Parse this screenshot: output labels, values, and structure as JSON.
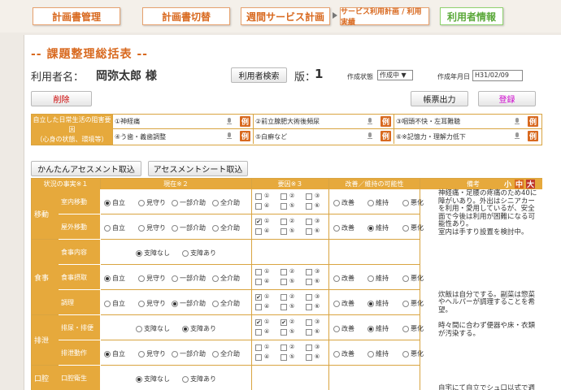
{
  "nav": {
    "tabs": [
      "計画書管理",
      "計画書切替",
      "週間サービス計画",
      "サービス利用計画 / 利用実績",
      "利用者情報"
    ]
  },
  "page": {
    "title": "-- 課題整理総括表 --",
    "user_label": "利用者名：",
    "user_name": "岡弥太郎 様",
    "search_button": "利用者検索",
    "version_label": "版：",
    "version": "1",
    "status_label": "作成状態",
    "status_value": "作成中 ▼",
    "date_label": "作成年月日",
    "date_value": "H31/02/09",
    "delete_button": "削除",
    "print_button": "帳票出力",
    "register_button": "登録",
    "easy_assess_button": "かんたんアセスメント取込",
    "assess_sheet_button": "アセスメントシート取込"
  },
  "header_block": {
    "label": "自立した日常生活の阻害要因\n（心身の状態、環境等）",
    "factors": [
      "①神経痛",
      "②前立腺肥大術後頻尿",
      "③咽頭不快・左耳難聴",
      "④う歯・義歯調整",
      "⑤白癬など",
      "⑥※記憶力・理解力低下"
    ],
    "rei": "例"
  },
  "table": {
    "headers": [
      "状況の事実※１",
      "現在※２",
      "要因※３",
      "改善／維持の可能性",
      "備考"
    ],
    "size_labels": [
      "小",
      "中",
      "大"
    ],
    "current_options": [
      "自立",
      "見守り",
      "一部介助",
      "全介助"
    ],
    "support_options": [
      "支障なし",
      "支障あり"
    ],
    "possibility_options": [
      "改善",
      "維持",
      "悪化"
    ],
    "factor_nums": [
      "①",
      "②",
      "③",
      "④",
      "⑤",
      "⑥"
    ],
    "categories": [
      "移動",
      "食事",
      "排泄",
      "口腔"
    ],
    "rows": [
      {
        "item": "室内移動",
        "type": "four",
        "sel": 0,
        "checks": [],
        "poss": -1
      },
      {
        "item": "屋外移動",
        "type": "four",
        "sel": -1,
        "checks": [
          0
        ],
        "poss": 1
      },
      {
        "item": "食事内容",
        "type": "two",
        "sel": 0,
        "checks": [],
        "poss": -1
      },
      {
        "item": "食事摂取",
        "type": "four",
        "sel": 0,
        "checks": [],
        "poss": -1
      },
      {
        "item": "調理",
        "type": "four",
        "sel": 2,
        "checks": [
          0
        ],
        "poss": 1
      },
      {
        "item": "排尿・排便",
        "type": "two",
        "sel": 1,
        "checks": [
          0,
          1
        ],
        "poss": 1
      },
      {
        "item": "排泄動作",
        "type": "four",
        "sel": 0,
        "checks": [],
        "poss": -1
      },
      {
        "item": "口腔衛生",
        "type": "two",
        "sel": 0,
        "checks": [],
        "poss": -1
      }
    ],
    "notes": "神経痛・足腰の疼痛のため40に障がいあり。外出はシニアカーを利用・愛用しているが、安全面で今後は利用が困難になる可能性あり。\n室内は手すり設置を検討中。\n\n\n\n\n\n\n\n炊飯は自分でする。副菜は惣菜やヘルパーが調理することを希望。\n\n時々間に合わず便器や床・衣類が汚染する。\n\n\n\n\n\n\n自宅にて自立でシュ口以式で週"
  },
  "colors": {
    "accent": "#d8691f",
    "header": "#e6a93c",
    "border": "#d9a441"
  }
}
